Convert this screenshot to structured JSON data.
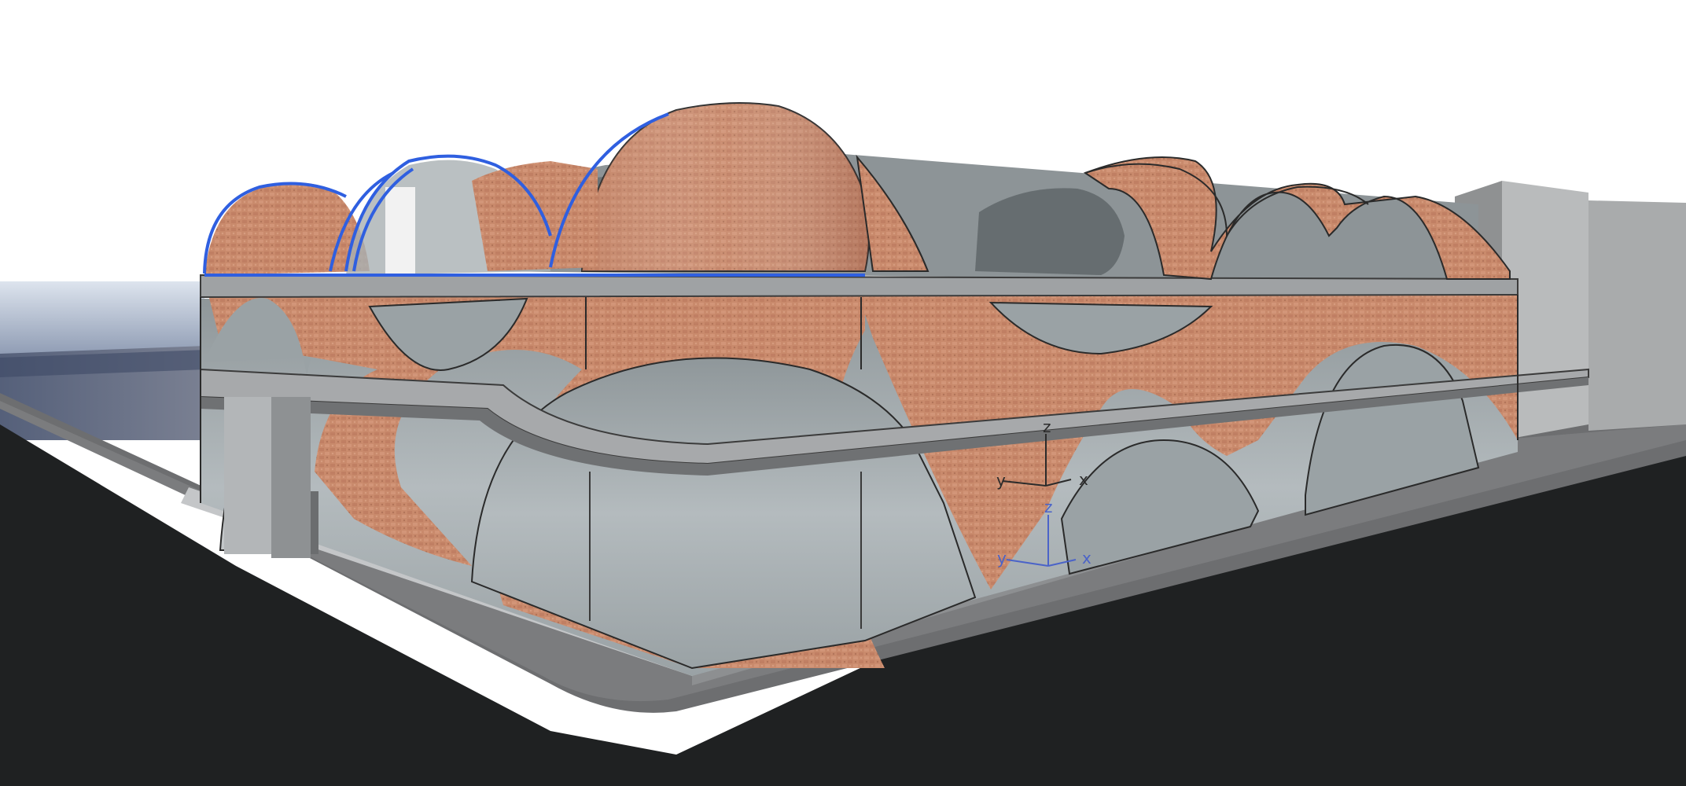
{
  "scene": {
    "colors": {
      "background": "#ffffff",
      "ground_dark": "#1f2122",
      "sidewalk": "#6d6e70",
      "slab": "#9a9c9e",
      "glass": "#a9b0b3",
      "glass_dark": "#5f6668",
      "brick": "#c98a6c",
      "brick_dark": "#a96c52",
      "selection_blue": "#2f5fe0",
      "neighbor_building": "#b9bbbc",
      "axis_black": "#2b2b2b",
      "axis_blue": "#4b63c8"
    },
    "gizmo_upper": {
      "z_label": "z",
      "y_label": "y",
      "x_label": "x"
    },
    "gizmo_lower": {
      "z_label": "z",
      "y_label": "y",
      "x_label": "x"
    }
  }
}
